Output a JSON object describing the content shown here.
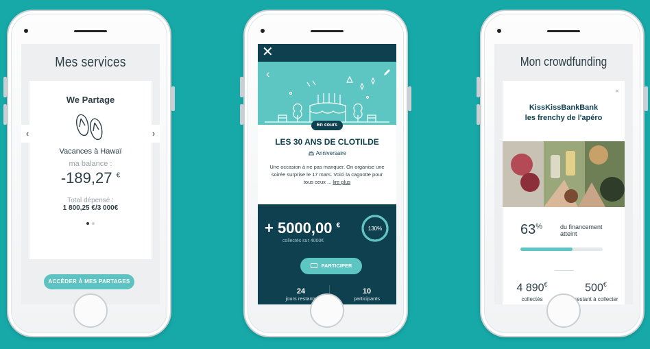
{
  "colors": {
    "background": "#16a9a8",
    "teal": "#5ec6c2",
    "dark_teal": "#0f4050",
    "text": "#2c3e46",
    "muted": "#9aa3a7"
  },
  "services": {
    "title": "Mes services",
    "card_title": "We Partage",
    "icon": "flip-flops-icon",
    "name": "Vacances à Hawaï",
    "balance_label": "ma balance :",
    "balance": "-189,27",
    "currency": "€",
    "total_label": "Total dépensé :",
    "total": "1 800,25 €/3 000€",
    "prev_arrow": "‹",
    "next_arrow": "›",
    "pager": {
      "pages": 2,
      "active": 0
    },
    "button": "ACCÉDER À MES PARTAGES"
  },
  "cagnotte": {
    "close": "✕",
    "back": "‹",
    "edit_icon": "pencil-icon",
    "hero_icon": "birthday-cake-icon",
    "badge": "En cours",
    "title": "LES 30 ANS DE CLOTILDE",
    "category_icon": "cake-icon",
    "category": "Anniversaire",
    "description": "Une occasion à ne pas manquer. On organise une soirée surprise le 17 mars. Voici la cagnotte pour tous ceux ...",
    "read_more": "lire plus",
    "amount": "+ 5000,00",
    "currency": "€",
    "amount_sub": "collectés sur 4000€",
    "progress_label": "130%",
    "progress": 1.3,
    "button_icon": "participate-icon",
    "button": "PARTICIPER",
    "days_value": "24",
    "days_label": "jours restants",
    "participants_value": "10",
    "participants_label": "participants"
  },
  "crowdfunding": {
    "title": "Mon crowdfunding",
    "close": "×",
    "project_line1": "KissKissBankBank",
    "project_line2": "les frenchy de l'apéro",
    "photo": "people-toasting-photo",
    "percent": "63",
    "percent_sign": "%",
    "percent_label_1": "du financement",
    "percent_label_2": "atteint",
    "progress": 0.63,
    "collected": "4 890",
    "collected_label": "collectés",
    "remaining": "500",
    "remaining_label": "restant à collecter",
    "currency": "€"
  }
}
